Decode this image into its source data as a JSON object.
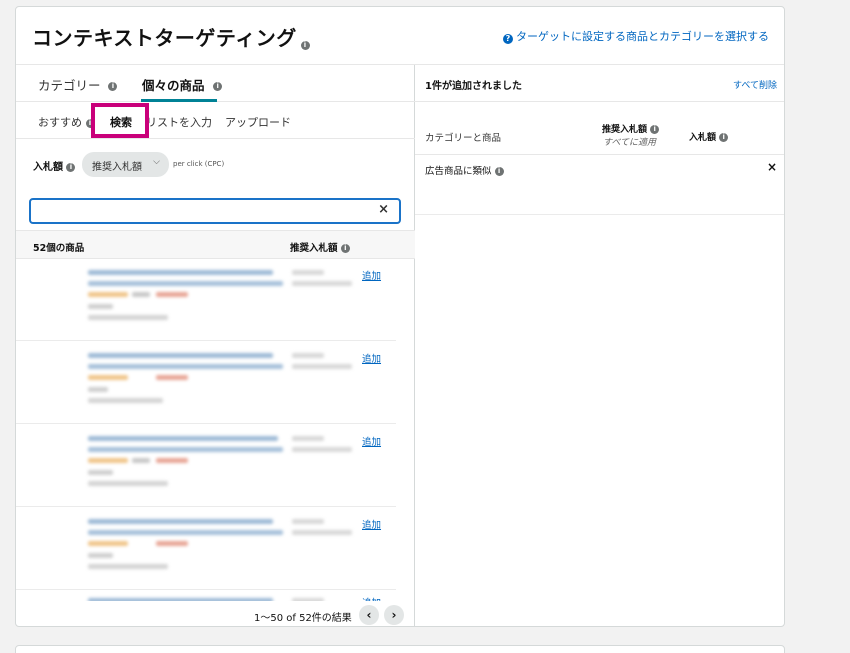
{
  "header": {
    "title": "コンテキストターゲティング",
    "info_icon": "i",
    "help_icon": "?",
    "help_link": "ターゲットに設定する商品とカテゴリーを選択する"
  },
  "tabs": {
    "category": "カテゴリー",
    "products": "個々の商品",
    "info_icon": "i"
  },
  "subtabs": {
    "recommended": "おすすめ",
    "search": "検索",
    "enter_list": "リストを入力",
    "upload": "アップロード"
  },
  "bid": {
    "label": "入札額",
    "selected": "推奨入札額",
    "chevron": "⌵",
    "note": "per click (CPC)"
  },
  "search": {
    "value": "",
    "clear": "×"
  },
  "list": {
    "count_label": "52個の商品",
    "suggested_bid_header": "推奨入札額",
    "add_label": "追加",
    "pagination": "1～50 of 52件の結果",
    "prev": "‹",
    "next": "›"
  },
  "right": {
    "added": "1件が追加されました",
    "remove_all": "すべて削除",
    "col_category": "カテゴリーと商品",
    "col_suggested": "推奨入札額",
    "col_suggested_sub": "すべてに適用",
    "col_bid": "入札額",
    "row_label": "広告商品に類似",
    "row_remove": "×"
  },
  "colors": {
    "link": "#0066c0",
    "tab_underline": "#008296",
    "highlight": "#c9007a",
    "focus": "#1a73c8"
  }
}
